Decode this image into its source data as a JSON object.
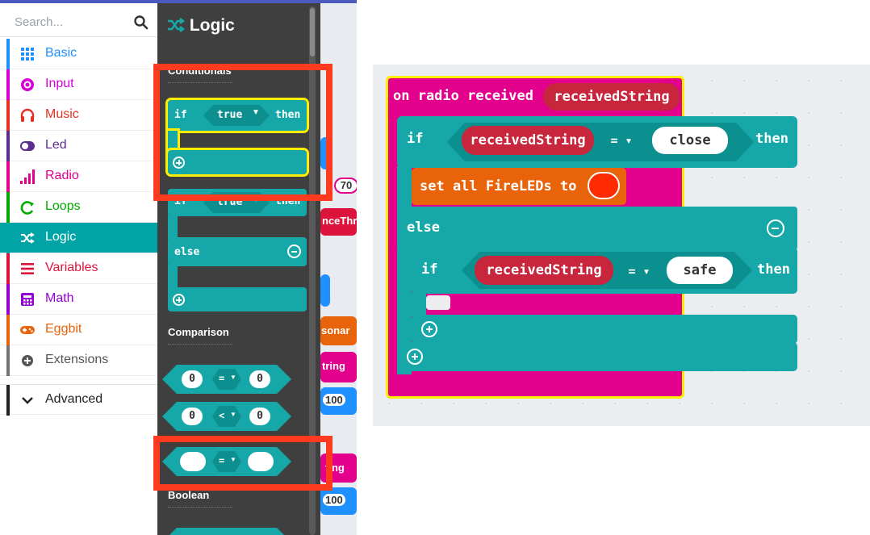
{
  "toolbox": {
    "search_placeholder": "Search...",
    "categories": [
      {
        "label": "Basic",
        "color": "#1e90ff",
        "icon": "grid-icon"
      },
      {
        "label": "Input",
        "color": "#d400d4",
        "icon": "target-icon"
      },
      {
        "label": "Music",
        "color": "#e63022",
        "icon": "headphones-icon"
      },
      {
        "label": "Led",
        "color": "#5c2d91",
        "icon": "toggle-icon"
      },
      {
        "label": "Radio",
        "color": "#e3008c",
        "icon": "signal-bars-icon"
      },
      {
        "label": "Loops",
        "color": "#00aa00",
        "icon": "loop-arrow-icon"
      },
      {
        "label": "Logic",
        "color": "#00a4a6",
        "icon": "shuffle-icon"
      },
      {
        "label": "Variables",
        "color": "#dc143c",
        "icon": "list-icon"
      },
      {
        "label": "Math",
        "color": "#9400d3",
        "icon": "calculator-icon"
      },
      {
        "label": "Eggbit",
        "color": "#e8630a",
        "icon": "gamepad-icon"
      },
      {
        "label": "Extensions",
        "color": "#757575",
        "icon": "plus-circle-icon"
      },
      {
        "label": "Advanced",
        "color": "#222222",
        "icon": "chevron-down-icon"
      }
    ]
  },
  "flyout": {
    "title": "Logic",
    "sections": {
      "conditionals": "Conditionals",
      "comparison": "Comparison",
      "boolean": "Boolean"
    },
    "if_block": {
      "if": "if",
      "cond": "true",
      "then": "then"
    },
    "if_else_block": {
      "if": "if",
      "cond": "true",
      "then": "then",
      "else": "else"
    },
    "compare_eq": {
      "left": "0",
      "op": "=",
      "right": "0"
    },
    "compare_lt": {
      "left": "0",
      "op": "<",
      "right": "0"
    },
    "compare_str": {
      "op": "="
    }
  },
  "edge_blocks": [
    "70",
    "nceThr",
    "sonar",
    "tring",
    "100",
    "ting",
    "100"
  ],
  "workspace": {
    "event": {
      "label": "on radio received",
      "param": "receivedString"
    },
    "if1": {
      "if": "if",
      "var": "receivedString",
      "op": "=",
      "str": "close",
      "then": "then"
    },
    "set_block": {
      "label": "set all FireLEDs to",
      "color": "#ff2a00"
    },
    "else": "else",
    "if2": {
      "if": "if",
      "var": "receivedString",
      "op": "=",
      "str": "safe",
      "then": "then"
    }
  },
  "colors": {
    "logic": "#16a8a8",
    "radio_event": "#e3008c",
    "highlight": "#ffee00",
    "variable": "#c7263c",
    "orange_block": "#e8630a",
    "annotation_red": "#ff3b1f"
  }
}
